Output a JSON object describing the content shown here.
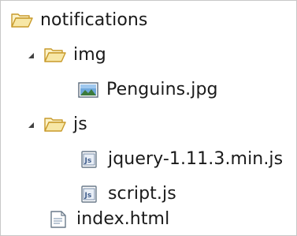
{
  "tree": {
    "root": {
      "label": "notifications",
      "icon": "folder-open-icon",
      "expanded": true
    },
    "img_folder": {
      "label": "img",
      "icon": "folder-open-icon",
      "expanded": true
    },
    "penguins_file": {
      "label": "Penguins.jpg",
      "icon": "image-file-icon"
    },
    "js_folder": {
      "label": "js",
      "icon": "folder-open-icon",
      "expanded": true
    },
    "jquery_file": {
      "label": "jquery-1.11.3.min.js",
      "icon": "js-file-icon"
    },
    "script_file": {
      "label": "script.js",
      "icon": "js-file-icon"
    },
    "index_file": {
      "label": "index.html",
      "icon": "html-file-icon"
    }
  },
  "colors": {
    "folder_fill": "#f7e7a6",
    "folder_stroke": "#c89a2a",
    "twisty": "#404040",
    "border": "#c8c8c8"
  }
}
